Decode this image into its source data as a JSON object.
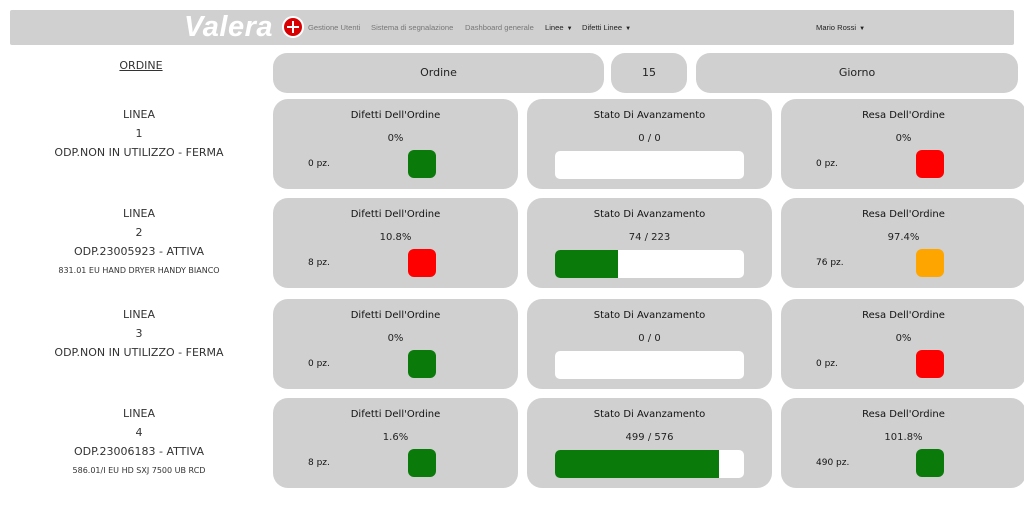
{
  "header": {
    "brand": "Valera",
    "nav": [
      {
        "label": "Gestione Utenti",
        "dropdown": false
      },
      {
        "label": "Sistema di segnalazione",
        "dropdown": false
      },
      {
        "label": "Dashboard generale",
        "dropdown": false
      },
      {
        "label": "Linee",
        "dropdown": true
      },
      {
        "label": "Difetti Linee",
        "dropdown": true
      }
    ],
    "user": "Mario Rossi"
  },
  "controls": {
    "ordine_heading": "ORDINE",
    "sort_label": "Ordine",
    "count": "15",
    "period_label": "Giorno"
  },
  "titles": {
    "defects": "Difetti Dell'Ordine",
    "progress": "Stato Di Avanzamento",
    "yield": "Resa Dell'Ordine"
  },
  "colors": {
    "green": "#0a7a0a",
    "red": "#ff0000",
    "orange": "#ffa500"
  },
  "lines": [
    {
      "label": "LINEA",
      "number": "1",
      "status": "ODP.NON IN UTILIZZO - FERMA",
      "product": "",
      "defects": {
        "percent": "0%",
        "pieces": "0 pz.",
        "indicator": "green"
      },
      "progress": {
        "text": "0 / 0",
        "fraction": 0
      },
      "yield": {
        "percent": "0%",
        "pieces": "0 pz.",
        "indicator": "red"
      }
    },
    {
      "label": "LINEA",
      "number": "2",
      "status": "ODP.23005923 - ATTIVA",
      "product": "831.01 EU HAND DRYER HANDY BIANCO",
      "defects": {
        "percent": "10.8%",
        "pieces": "8 pz.",
        "indicator": "red"
      },
      "progress": {
        "text": "74 / 223",
        "fraction": 0.332
      },
      "yield": {
        "percent": "97.4%",
        "pieces": "76 pz.",
        "indicator": "orange"
      }
    },
    {
      "label": "LINEA",
      "number": "3",
      "status": "ODP.NON IN UTILIZZO - FERMA",
      "product": "",
      "defects": {
        "percent": "0%",
        "pieces": "0 pz.",
        "indicator": "green"
      },
      "progress": {
        "text": "0 / 0",
        "fraction": 0
      },
      "yield": {
        "percent": "0%",
        "pieces": "0 pz.",
        "indicator": "red"
      }
    },
    {
      "label": "LINEA",
      "number": "4",
      "status": "ODP.23006183 - ATTIVA",
      "product": "586.01/I EU HD SXJ 7500 UB RCD",
      "defects": {
        "percent": "1.6%",
        "pieces": "8 pz.",
        "indicator": "green"
      },
      "progress": {
        "text": "499 / 576",
        "fraction": 0.866
      },
      "yield": {
        "percent": "101.8%",
        "pieces": "490 pz.",
        "indicator": "green"
      }
    }
  ]
}
